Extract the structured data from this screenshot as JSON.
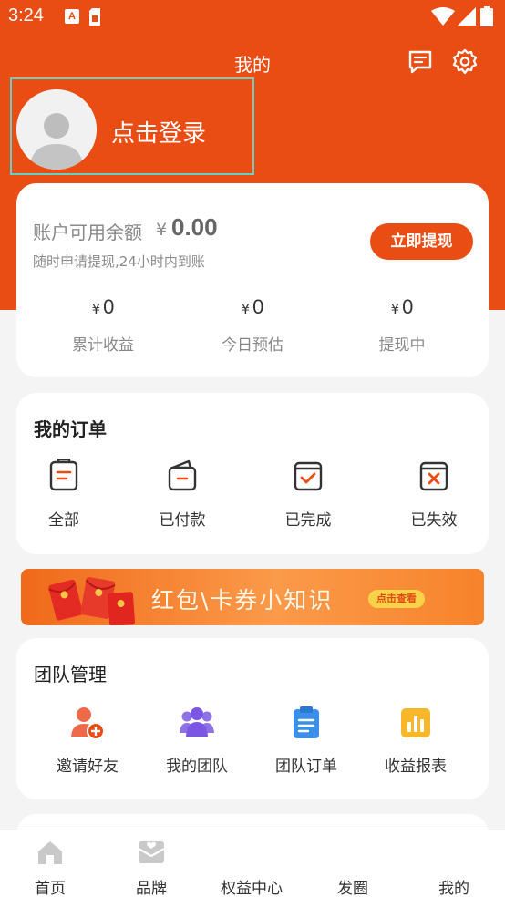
{
  "status_bar": {
    "time": "3:24",
    "notif_glyph": "A"
  },
  "header": {
    "title": "我的"
  },
  "user": {
    "login_label": "点击登录"
  },
  "balance": {
    "label": "账户可用余额",
    "currency": "¥",
    "amount": "0.00",
    "subtitle": "随时申请提现,24小时内到账",
    "withdraw_label": "立即提现",
    "stats": [
      {
        "currency": "¥",
        "value": "0",
        "label": "累计收益"
      },
      {
        "currency": "¥",
        "value": "0",
        "label": "今日预估"
      },
      {
        "currency": "¥",
        "value": "0",
        "label": "提现中"
      }
    ]
  },
  "orders": {
    "title": "我的订单",
    "items": [
      {
        "label": "全部",
        "icon": "clipboard-icon"
      },
      {
        "label": "已付款",
        "icon": "wallet-icon"
      },
      {
        "label": "已完成",
        "icon": "check-bag-icon"
      },
      {
        "label": "已失效",
        "icon": "x-bag-icon"
      }
    ]
  },
  "banner": {
    "text": "红包\\卡券小知识",
    "button": "点击查看"
  },
  "team": {
    "title": "团队管理",
    "items": [
      {
        "label": "邀请好友",
        "icon": "invite-user-icon"
      },
      {
        "label": "我的团队",
        "icon": "team-icon"
      },
      {
        "label": "团队订单",
        "icon": "team-order-icon"
      },
      {
        "label": "收益报表",
        "icon": "chart-report-icon"
      }
    ]
  },
  "tabbar": {
    "items": [
      {
        "label": "首页",
        "icon": "home-icon"
      },
      {
        "label": "品牌",
        "icon": "brand-icon"
      },
      {
        "label": "权益中心",
        "icon": ""
      },
      {
        "label": "发圈",
        "icon": ""
      },
      {
        "label": "我的",
        "icon": ""
      }
    ]
  },
  "colors": {
    "primary": "#ea4d14",
    "background": "#f4f4f4",
    "highlight_border": "#5fd2c9"
  }
}
